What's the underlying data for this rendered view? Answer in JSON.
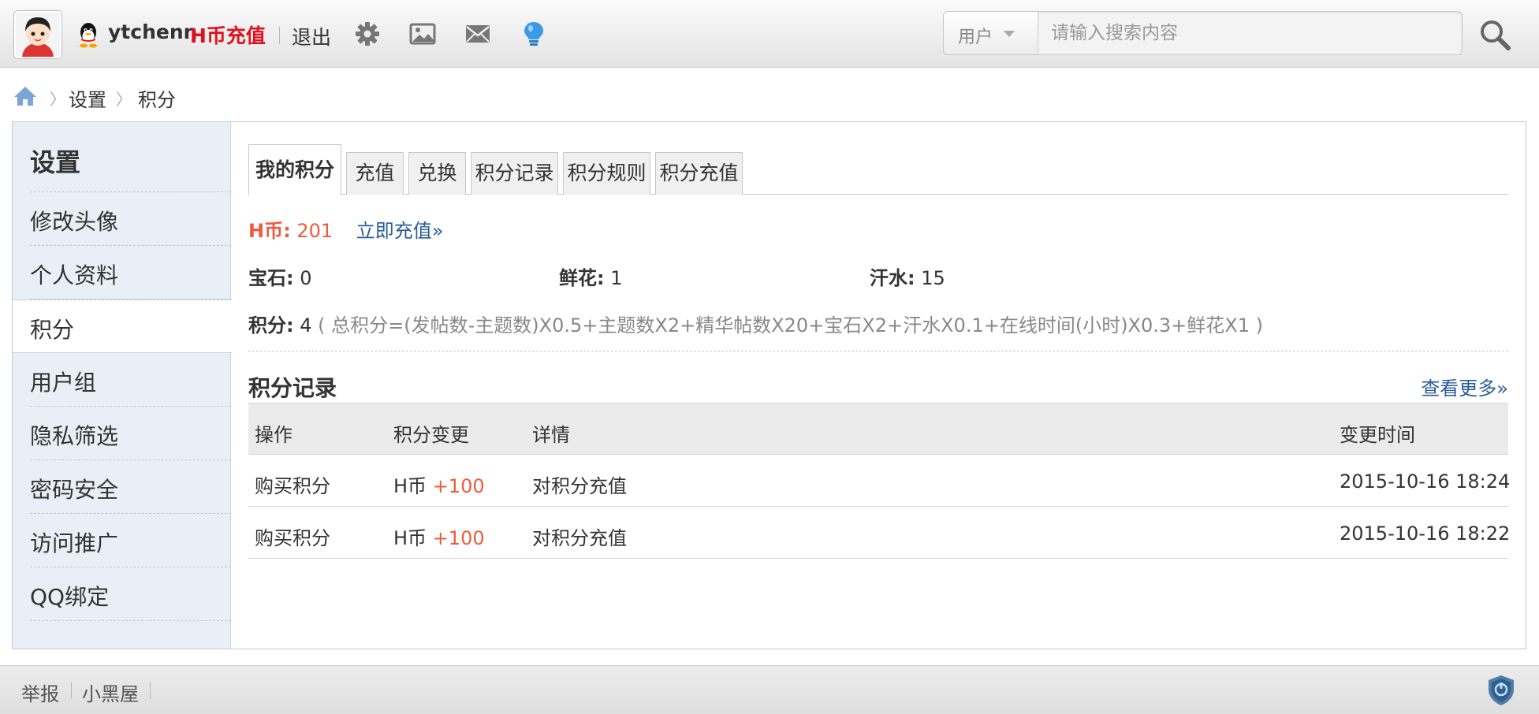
{
  "header": {
    "username": "ytchenn",
    "hcoin_link": "H币充值",
    "logout": "退出",
    "search": {
      "type_label": "用户",
      "placeholder": "请输入搜索内容"
    },
    "icons": [
      "avatar",
      "qq-icon",
      "settings-icon",
      "image-icon",
      "mail-icon",
      "bulb-icon",
      "search-icon"
    ]
  },
  "breadcrumb": {
    "items": [
      "设置",
      "积分"
    ]
  },
  "sidebar": {
    "title": "设置",
    "items": [
      {
        "label": "修改头像"
      },
      {
        "label": "个人资料"
      },
      {
        "label": "积分"
      },
      {
        "label": "用户组"
      },
      {
        "label": "隐私筛选"
      },
      {
        "label": "密码安全"
      },
      {
        "label": "访问推广"
      },
      {
        "label": "QQ绑定"
      }
    ],
    "active_index": 2
  },
  "tabs": [
    {
      "label": "我的积分"
    },
    {
      "label": "充值"
    },
    {
      "label": "兑换"
    },
    {
      "label": "积分记录"
    },
    {
      "label": "积分规则"
    },
    {
      "label": "积分充值"
    }
  ],
  "hcoin": {
    "label": "H币:",
    "value": "201",
    "recharge": "立即充值»"
  },
  "stats": {
    "gem": {
      "label": "宝石:",
      "value": "0"
    },
    "flower": {
      "label": "鲜花:",
      "value": "1"
    },
    "sweat": {
      "label": "汗水:",
      "value": "15"
    }
  },
  "score": {
    "label": "积分:",
    "value": "4",
    "formula": "( 总积分=(发帖数-主题数)X0.5+主题数X2+精华帖数X20+宝石X2+汗水X0.1+在线时间(小时)X0.3+鲜花X1 )"
  },
  "records": {
    "title": "积分记录",
    "more": "查看更多»",
    "columns": [
      "操作",
      "积分变更",
      "详情",
      "变更时间"
    ],
    "rows": [
      {
        "action": "购买积分",
        "currency": "H币",
        "change": "+100",
        "detail": "对积分充值",
        "time": "2015-10-16 18:24"
      },
      {
        "action": "购买积分",
        "currency": "H币",
        "change": "+100",
        "detail": "对积分充值",
        "time": "2015-10-16 18:22"
      }
    ]
  },
  "footer": {
    "links": [
      "举报",
      "小黑屋"
    ]
  },
  "colors": {
    "hcoin_red": "#e0101f",
    "accent_orange": "#f05a3c",
    "link_blue": "#2a5c99",
    "sidebar_bg": "#e8eff7"
  }
}
